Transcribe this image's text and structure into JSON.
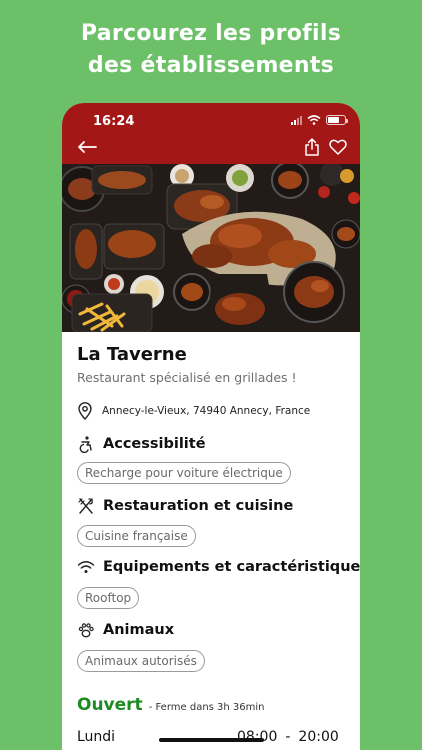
{
  "headline": {
    "line1": "Parcourez les profils",
    "line2": "des établissements"
  },
  "status_bar": {
    "time": "16:24"
  },
  "colors": {
    "background": "#6cc067",
    "topbar": "#a31717",
    "open": "#1e8a24"
  },
  "icons": [
    "back-arrow-icon",
    "share-icon",
    "heart-icon",
    "location-pin-icon",
    "accessibility-icon",
    "utensils-icon",
    "wifi-icon",
    "paw-icon"
  ],
  "place": {
    "name": "La Taverne",
    "tagline": "Restaurant spécialisé en grillades !",
    "address": "Annecy-le-Vieux, 74940 Annecy, France"
  },
  "sections": [
    {
      "title": "Accessibilité",
      "chip": "Recharge pour voiture électrique"
    },
    {
      "title": "Restauration et cuisine",
      "chip": "Cuisine française"
    },
    {
      "title": "Equipements et caractéristiques",
      "chip": "Rooftop"
    },
    {
      "title": "Animaux",
      "chip": "Animaux autorisés"
    }
  ],
  "status": {
    "open": "Ouvert",
    "detail": "- Ferme dans 3h 36min"
  },
  "hours": [
    {
      "day": "Lundi",
      "open": "08:00",
      "sep": "-",
      "close": "20:00"
    }
  ]
}
